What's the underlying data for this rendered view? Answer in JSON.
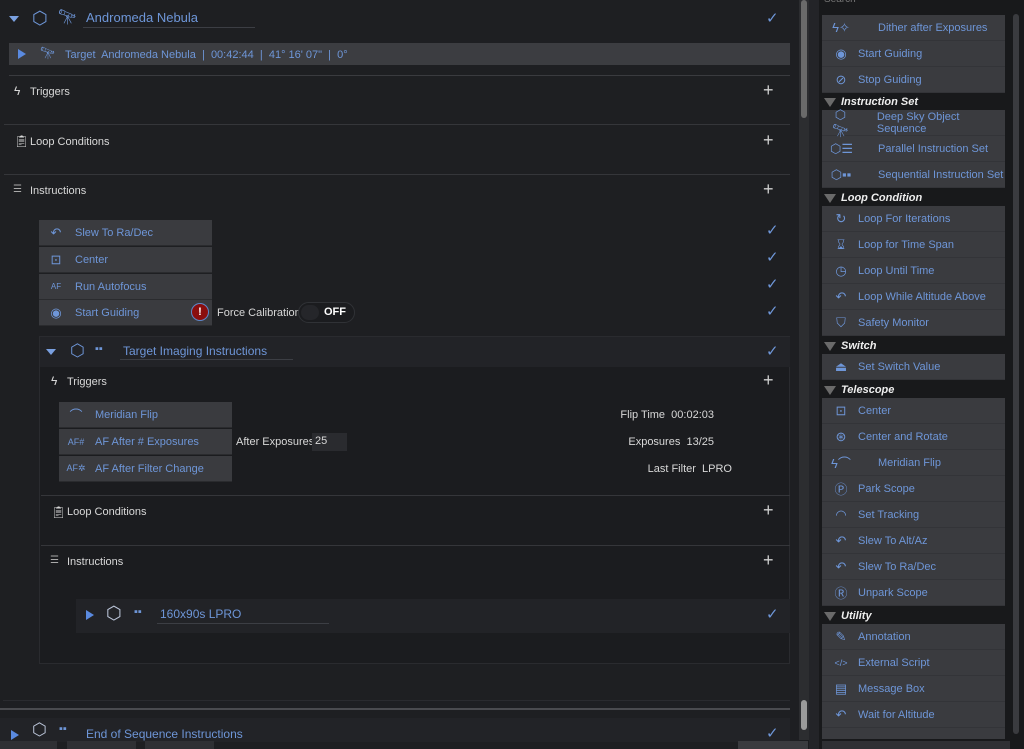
{
  "sequence": {
    "title": "Andromeda Nebula",
    "target_line": "Target  Andromeda Nebula  |  00:42:44  |  41° 16' 07\"  |  0°",
    "sections": {
      "triggers": "Triggers",
      "loop_conditions": "Loop Conditions",
      "instructions": "Instructions"
    },
    "instructions": [
      {
        "label": "Slew To Ra/Dec",
        "icon": "slew-radec-icon"
      },
      {
        "label": "Center",
        "icon": "center-icon"
      },
      {
        "label": "Run Autofocus",
        "icon": "autofocus-icon"
      },
      {
        "label": "Start Guiding",
        "icon": "guiding-icon"
      }
    ],
    "start_guiding": {
      "warning": "!",
      "force_calibration_label": "Force Calibration",
      "toggle_value": "OFF"
    },
    "target_imaging": {
      "title": "Target Imaging Instructions",
      "sections": {
        "triggers": "Triggers",
        "loop_conditions": "Loop Conditions",
        "instructions": "Instructions"
      },
      "triggers": [
        {
          "label": "Meridian Flip",
          "icon": "meridian-flip-icon",
          "info_label": "Flip Time",
          "info_value": "00:02:03"
        },
        {
          "label": "AF After # Exposures",
          "icon": "af-exposures-icon",
          "param_label": "After Exposures",
          "param_value": "25",
          "info_label": "Exposures",
          "info_value": "13/25"
        },
        {
          "label": "AF After Filter Change",
          "icon": "af-filter-icon",
          "info_label": "Last Filter",
          "info_value": "LPRO"
        }
      ],
      "sub_set": {
        "title": "160x90s LPRO"
      }
    },
    "end_block": {
      "title": "End of Sequence Instructions"
    }
  },
  "sidebar": {
    "search_placeholder": "Search",
    "top_items": [
      {
        "label": "Dither after Exposures",
        "icon": "dither-icon"
      },
      {
        "label": "Start Guiding",
        "icon": "guiding-icon"
      },
      {
        "label": "Stop Guiding",
        "icon": "stop-guiding-icon"
      }
    ],
    "categories": [
      {
        "name": "Instruction Set",
        "items": [
          {
            "label": "Deep Sky Object Sequence",
            "icon": "dso-icon"
          },
          {
            "label": "Parallel Instruction Set",
            "icon": "parallel-icon"
          },
          {
            "label": "Sequential Instruction Set",
            "icon": "sequential-icon"
          }
        ]
      },
      {
        "name": "Loop Condition",
        "items": [
          {
            "label": "Loop For Iterations",
            "icon": "loop-icon"
          },
          {
            "label": "Loop for Time Span",
            "icon": "hourglass-icon"
          },
          {
            "label": "Loop Until Time",
            "icon": "clock-icon"
          },
          {
            "label": "Loop While Altitude Above",
            "icon": "altitude-icon"
          },
          {
            "label": "Safety Monitor",
            "icon": "shield-icon"
          }
        ]
      },
      {
        "name": "Switch",
        "items": [
          {
            "label": "Set Switch Value",
            "icon": "switch-icon"
          }
        ]
      },
      {
        "name": "Telescope",
        "items": [
          {
            "label": "Center",
            "icon": "center-icon"
          },
          {
            "label": "Center and Rotate",
            "icon": "center-rotate-icon"
          },
          {
            "label": "Meridian Flip",
            "icon": "meridian-flip-icon"
          },
          {
            "label": "Park Scope",
            "icon": "park-icon"
          },
          {
            "label": "Set Tracking",
            "icon": "tracking-icon"
          },
          {
            "label": "Slew To Alt/Az",
            "icon": "slew-altaz-icon"
          },
          {
            "label": "Slew To Ra/Dec",
            "icon": "slew-radec-icon"
          },
          {
            "label": "Unpark Scope",
            "icon": "unpark-icon"
          }
        ]
      },
      {
        "name": "Utility",
        "items": [
          {
            "label": "Annotation",
            "icon": "pencil-icon"
          },
          {
            "label": "External Script",
            "icon": "code-icon"
          },
          {
            "label": "Message Box",
            "icon": "message-box-icon"
          },
          {
            "label": "Wait for Altitude",
            "icon": "altitude-icon"
          }
        ]
      }
    ]
  }
}
